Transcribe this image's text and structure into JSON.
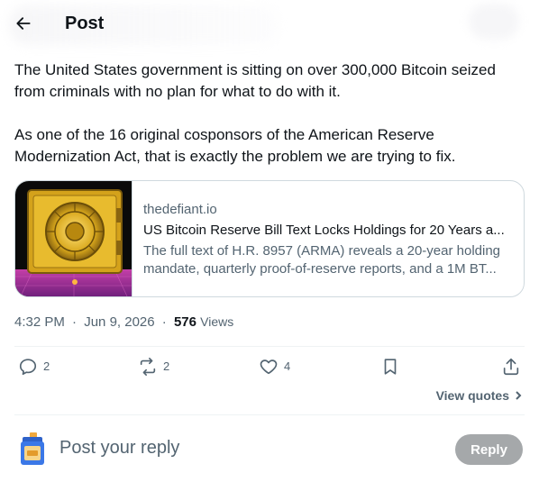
{
  "header": {
    "title": "Post",
    "back_icon": "arrow-left-icon"
  },
  "post": {
    "paragraphs": [
      "The United States government is sitting on over 300,000 Bitcoin seized from criminals with no plan for what to do with it.",
      "As one of the 16 original cosponsors of the American Reserve Modernization Act, that is exactly the problem we are trying to fix."
    ]
  },
  "link_card": {
    "domain": "thedefiant.io",
    "title": "US Bitcoin Reserve Bill Text Locks Holdings for 20 Years a...",
    "description": "The full text of H.R. 8957 (ARMA) reveals a 20-year holding mandate, quarterly proof-of-reserve reports, and a 1M BT...",
    "thumbnail": "bitcoin-vault-image"
  },
  "meta": {
    "time": "4:32 PM",
    "separator": "·",
    "date": "Jun 9, 2026",
    "views_count": "576",
    "views_label": "Views"
  },
  "actions": {
    "replies": "2",
    "reposts": "2",
    "likes": "4"
  },
  "view_quotes": "View quotes",
  "reply": {
    "placeholder": "Post your reply",
    "button_label": "Reply"
  },
  "colors": {
    "text": "#0f1419",
    "secondary": "#536471",
    "border": "#cfd9de",
    "reply_button": "#8f9396"
  }
}
